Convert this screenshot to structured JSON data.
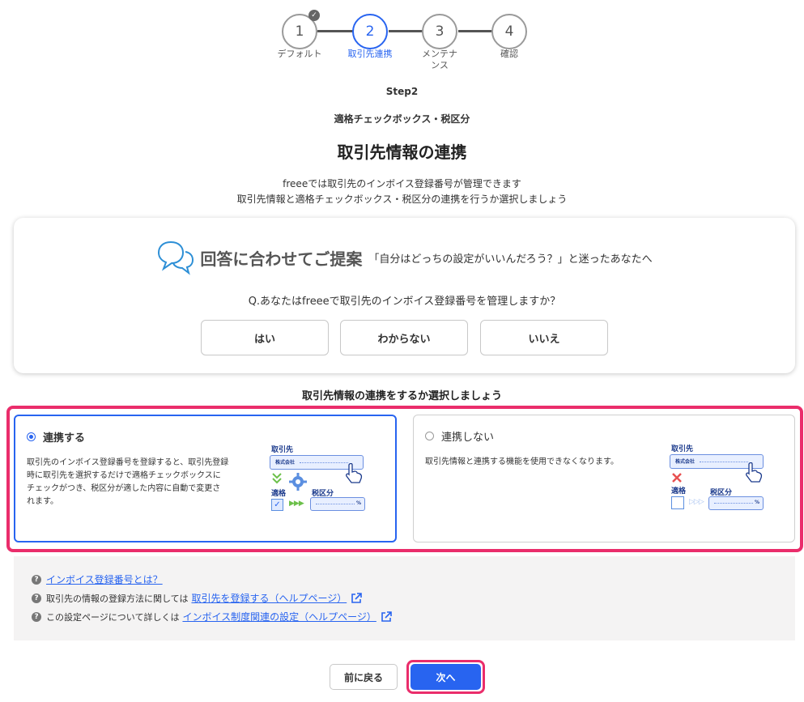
{
  "stepper": {
    "steps": [
      {
        "number": "1",
        "label": "デフォルト",
        "state": "done"
      },
      {
        "number": "2",
        "label": "取引先連携",
        "state": "active"
      },
      {
        "number": "3",
        "label": "メンテナンス",
        "state": "todo"
      },
      {
        "number": "4",
        "label": "確認",
        "state": "todo"
      }
    ],
    "check_glyph": "✓"
  },
  "header": {
    "step_label": "Step2",
    "section_label": "適格チェックボックス・税区分",
    "title": "取引先情報の連携",
    "desc_line1": "freeeでは取引先のインボイス登録番号が管理できます",
    "desc_line2": "取引先情報と適格チェックボックス・税区分の連携を行うか選択しましょう"
  },
  "proposal": {
    "icon": "speech-bubbles-icon",
    "title": "回答に合わせてご提案",
    "subtitle": "「自分はどっちの設定がいいんだろう？」と迷ったあなたへ",
    "question": "Q.あなたはfreeeで取引先のインボイス登録番号を管理しますか？",
    "answers": [
      "はい",
      "わからない",
      "いいえ"
    ]
  },
  "choose_title": "取引先情報の連携をするか選択しましょう",
  "options": {
    "link": {
      "title": "連携する",
      "selected": true,
      "desc_lines": [
        "取引先のインボイス登録番号を登録すると、取引先登録",
        "時に取引先を選択するだけで適格チェックボックスに",
        "チェックがつき、税区分が適した内容に自動で変更さ",
        "れます。"
      ],
      "illus": {
        "partner": "取引先",
        "company": "株式会社",
        "qualified": "適格",
        "tax": "税区分",
        "percent": "%"
      }
    },
    "nolink": {
      "title": "連携しない",
      "selected": false,
      "desc_lines": [
        "取引先情報と連携する機能を使用できなくなります。"
      ],
      "illus": {
        "partner": "取引先",
        "company": "株式会社",
        "qualified": "適格",
        "tax": "税区分",
        "percent": "%"
      }
    }
  },
  "help": {
    "link1": "インボイス登録番号とは？",
    "row2_prefix": "取引先の情報の登録方法に関しては",
    "link2": "取引先を登録する（ヘルプページ）",
    "row3_prefix": "この設定ページについて詳しくは",
    "link3": "インボイス制度関連の設定（ヘルプページ）",
    "q_glyph": "?"
  },
  "footer": {
    "back_label": "前に戻る",
    "next_label": "次へ"
  },
  "colors": {
    "accent": "#2864f0",
    "highlight": "#ea2d6b"
  }
}
